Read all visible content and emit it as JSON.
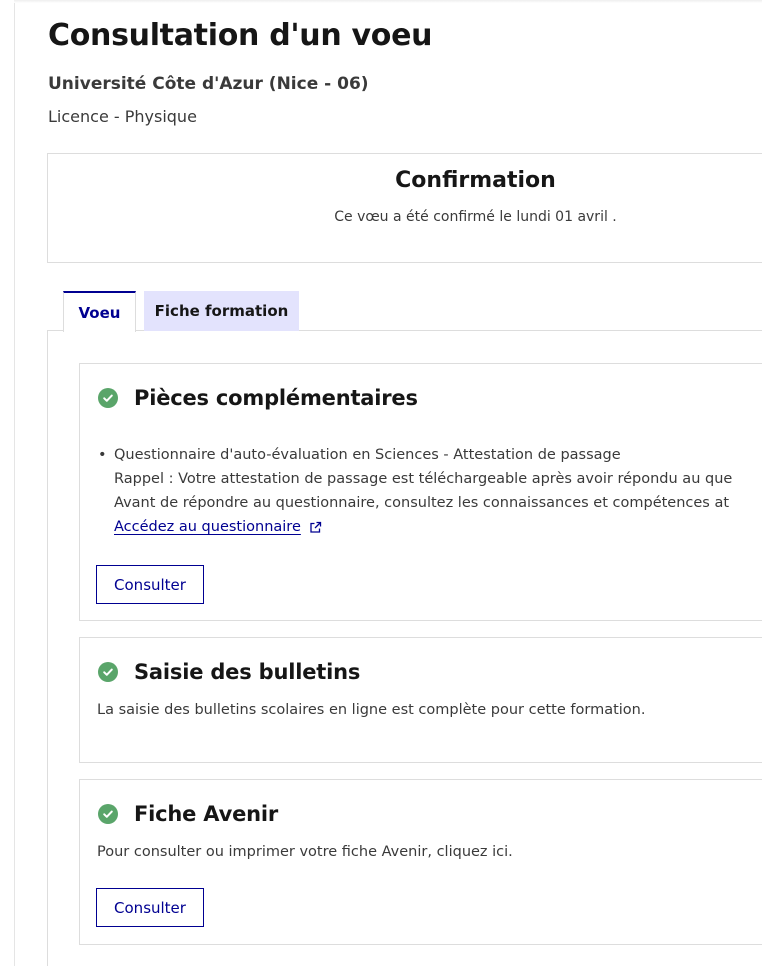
{
  "header": {
    "title": "Consultation d'un voeu",
    "university": "Université Côte d'Azur (Nice - 06)",
    "program": "Licence - Physique"
  },
  "confirmation": {
    "title": "Confirmation",
    "text": "Ce vœu a été confirmé le lundi 01 avril ."
  },
  "tabs": [
    {
      "label": "Voeu",
      "active": true
    },
    {
      "label": "Fiche formation",
      "active": false
    }
  ],
  "sections": {
    "pieces": {
      "title": "Pièces complémentaires",
      "status_icon": "check-circle-icon",
      "item_title": "Questionnaire d'auto-évaluation en Sciences - Attestation de passage",
      "item_line_2": "Rappel : Votre attestation de passage est téléchargeable après avoir répondu au que",
      "item_line_3": "Avant de répondre au questionnaire, consultez les connaissances et compétences at",
      "link_label": "Accédez au questionnaire",
      "link_icon": "external-link-icon",
      "button_label": "Consulter"
    },
    "bulletins": {
      "title": "Saisie des bulletins",
      "status_icon": "check-circle-icon",
      "text": "La saisie des bulletins scolaires en ligne est complète pour cette formation."
    },
    "avenir": {
      "title": "Fiche Avenir",
      "status_icon": "check-circle-icon",
      "text": "Pour consulter ou imprimer votre fiche Avenir, cliquez ici.",
      "button_label": "Consulter"
    }
  },
  "colors": {
    "primary": "#000091",
    "success": "#5aa56a",
    "tab_inactive_bg": "#e3e3fd",
    "border": "#dddddd",
    "text": "#3a3a3a"
  }
}
